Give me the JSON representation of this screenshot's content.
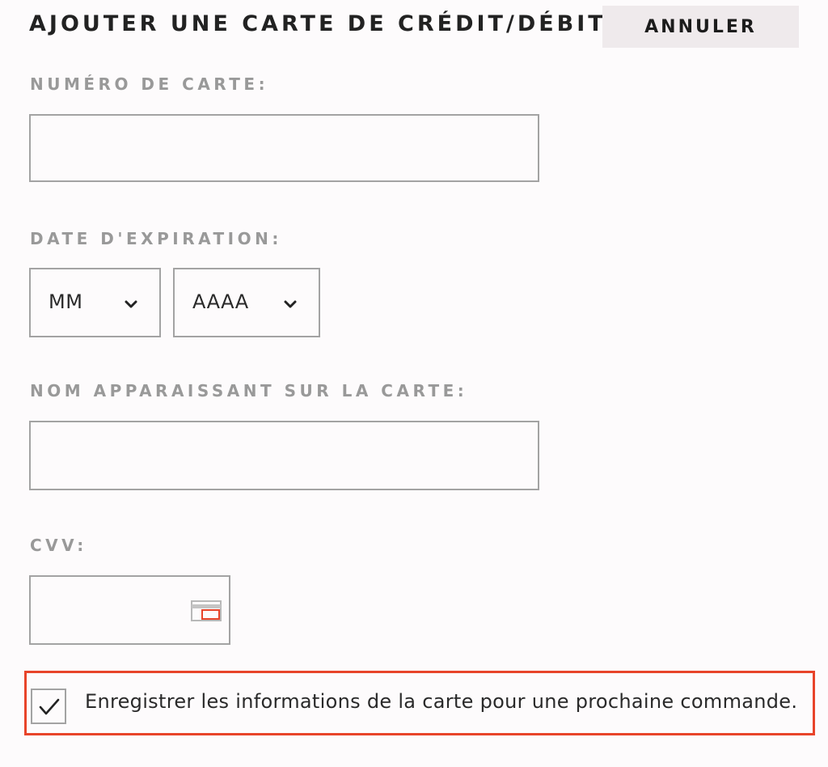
{
  "header": {
    "title": "AJOUTER UNE CARTE DE CRÉDIT/DÉBIT",
    "cancel_label": "ANNULER"
  },
  "form": {
    "card_number": {
      "label": "NUMÉRO DE CARTE:",
      "value": ""
    },
    "expiration": {
      "label": "DATE D'EXPIRATION:",
      "month_value": "MM",
      "year_value": "AAAA"
    },
    "name_on_card": {
      "label": "NOM APPARAISSANT SUR LA CARTE:",
      "value": ""
    },
    "cvv": {
      "label": "CVV:",
      "value": "",
      "icon": "card-cvv-icon"
    },
    "save_card": {
      "checked": true,
      "label": "Enregistrer les informations de la carte pour une prochaine commande."
    }
  },
  "colors": {
    "background": "#fdfbfc",
    "title_text": "#222222",
    "label_text": "#999999",
    "field_border": "#a3a3a3",
    "cancel_bg": "#efeaec",
    "highlight": "#e8442a"
  }
}
